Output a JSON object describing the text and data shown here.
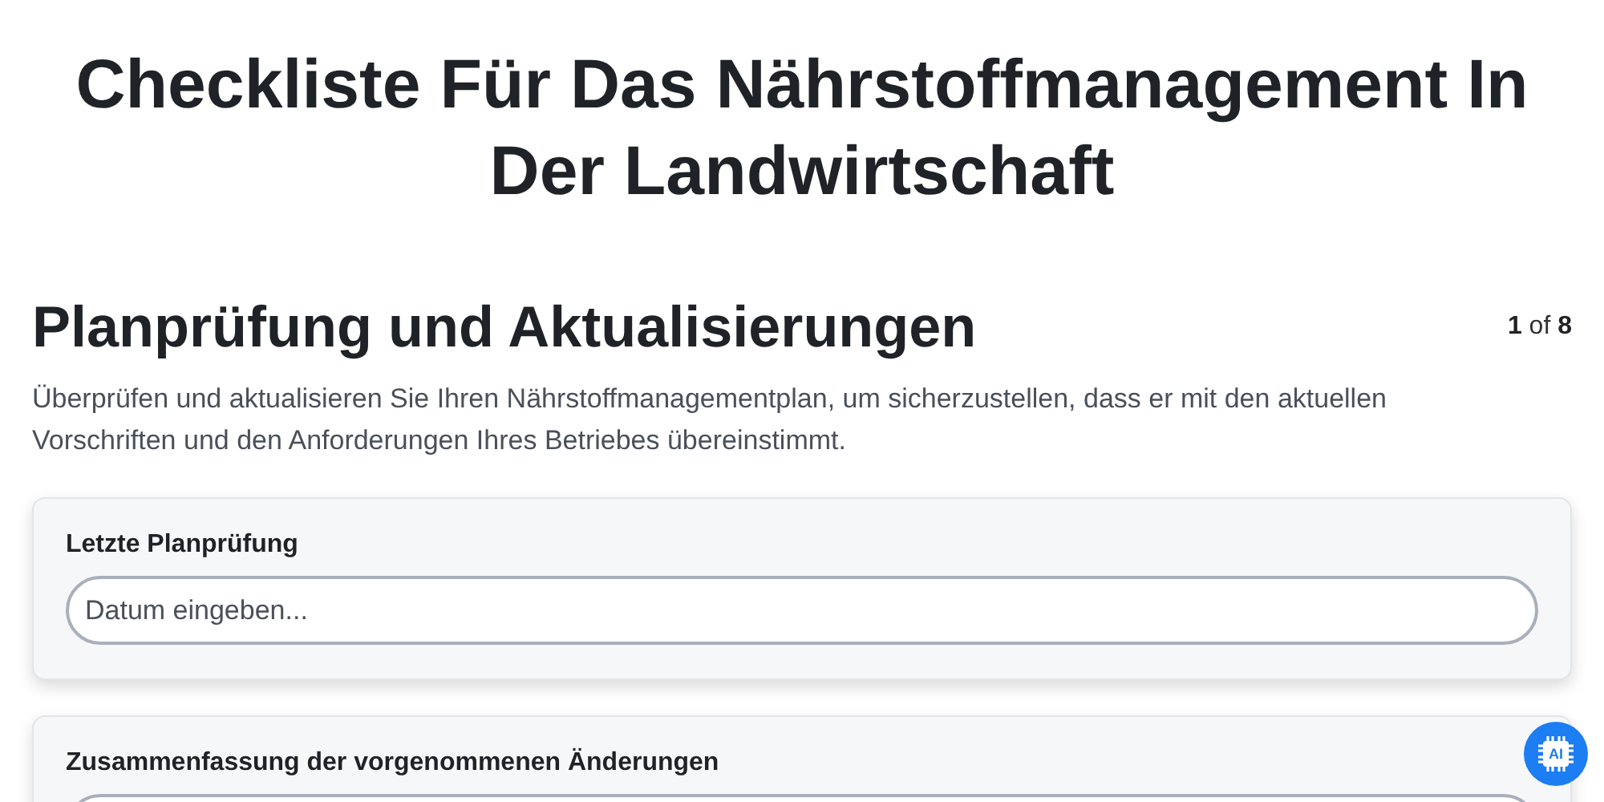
{
  "title": "Checkliste Für Das Nährstoffmanagement In Der Landwirtschaft",
  "section": {
    "heading": "Planprüfung und Aktualisierungen",
    "counter": {
      "current": "1",
      "separator": "of",
      "total": "8"
    },
    "description": "Überprüfen und aktualisieren Sie Ihren Nährstoffmanagementplan, um sicherzustellen, dass er mit den aktuellen Vorschriften und den Anforderungen Ihres Betriebes übereinstimmt."
  },
  "fields": [
    {
      "label": "Letzte Planprüfung",
      "placeholder": "Datum eingeben..."
    },
    {
      "label": "Zusammenfassung der vorgenommenen Änderungen"
    }
  ],
  "ai_badge": {
    "text": "AI"
  }
}
